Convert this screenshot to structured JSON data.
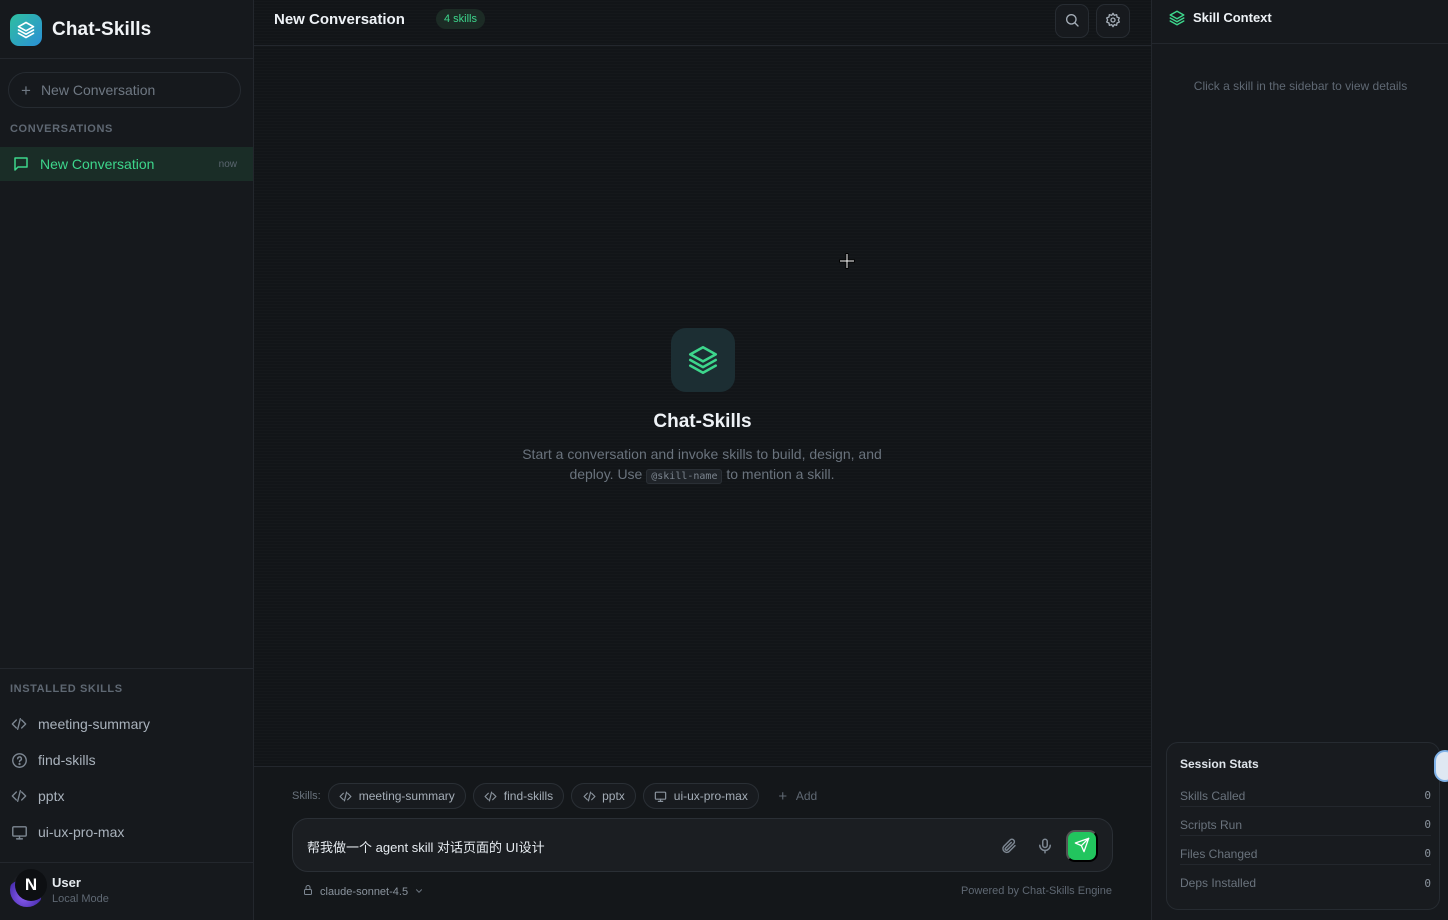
{
  "brand": {
    "title": "Chat-Skills"
  },
  "sidebar": {
    "new_conversation_label": "New Conversation",
    "conversations_heading": "CONVERSATIONS",
    "conversations": [
      {
        "label": "New Conversation",
        "time": "now",
        "active": true
      }
    ],
    "installed_skills_heading": "INSTALLED SKILLS",
    "skills": [
      {
        "label": "meeting-summary",
        "icon": "code-icon"
      },
      {
        "label": "find-skills",
        "icon": "help-circle-icon"
      },
      {
        "label": "pptx",
        "icon": "code-icon"
      },
      {
        "label": "ui-ux-pro-max",
        "icon": "monitor-icon"
      }
    ],
    "user": {
      "initial": "N",
      "name": "User",
      "mode": "Local Mode"
    }
  },
  "header": {
    "title": "New Conversation",
    "skills_badge": "4 skills"
  },
  "welcome": {
    "title": "Chat-Skills",
    "desc_before": "Start a conversation and invoke skills to build, design, and deploy. Use ",
    "desc_code": "@skill-name",
    "desc_after": " to mention a skill."
  },
  "composer": {
    "skills_label": "Skills:",
    "skill_chips": [
      {
        "label": "meeting-summary",
        "icon": "code-icon"
      },
      {
        "label": "find-skills",
        "icon": "code-icon"
      },
      {
        "label": "pptx",
        "icon": "code-icon"
      },
      {
        "label": "ui-ux-pro-max",
        "icon": "monitor-icon"
      }
    ],
    "add_label": "Add",
    "input_value": "帮我做一个 agent skill 对话页面的 UI设计",
    "model": "claude-sonnet-4.5",
    "powered_by": "Powered by Chat-Skills Engine"
  },
  "right_panel": {
    "title": "Skill Context",
    "hint": "Click a skill in the sidebar to view details",
    "stats": {
      "title": "Session Stats",
      "rows": [
        {
          "label": "Skills Called",
          "value": "0"
        },
        {
          "label": "Scripts Run",
          "value": "0"
        },
        {
          "label": "Files Changed",
          "value": "0"
        },
        {
          "label": "Deps Installed",
          "value": "0"
        }
      ]
    }
  },
  "colors": {
    "accent": "#22c55e",
    "accent_text": "#3dd68c",
    "background": "#121518",
    "sidebar": "#16191d"
  }
}
